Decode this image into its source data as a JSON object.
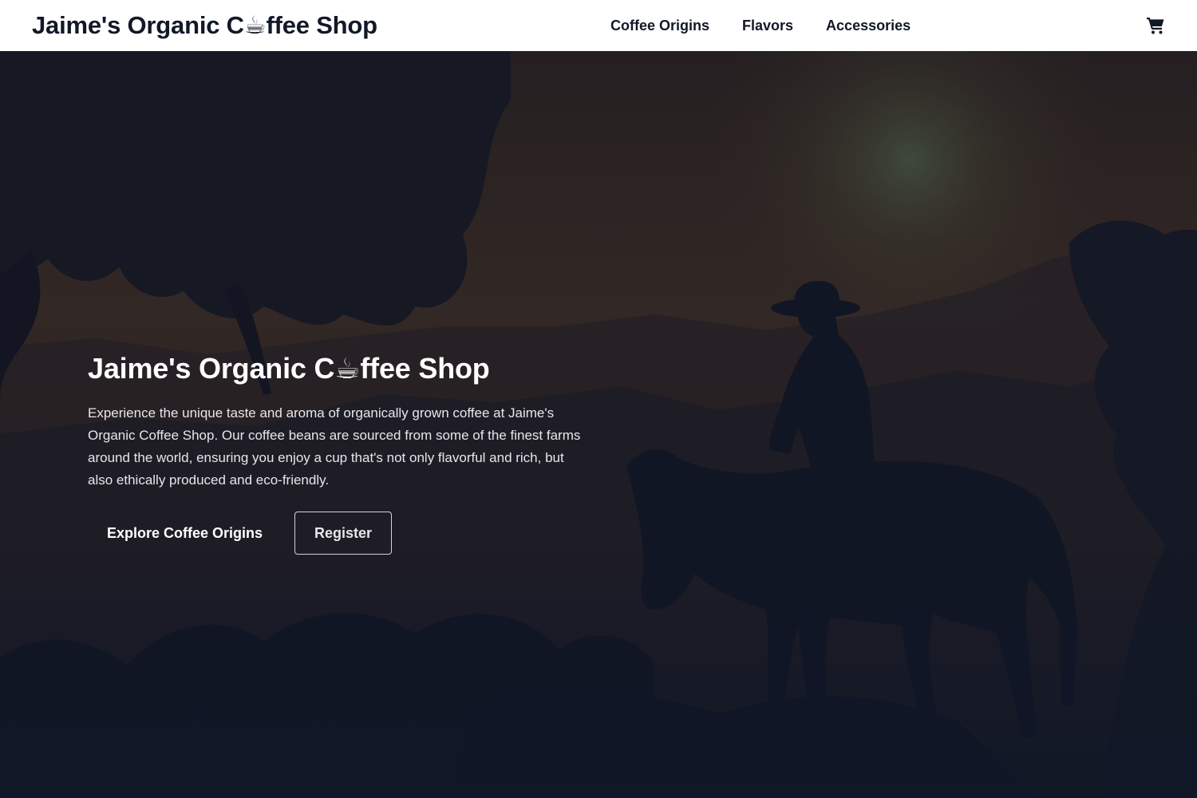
{
  "header": {
    "brand_prefix": "Jaime's Organic C",
    "brand_cup": "☕",
    "brand_suffix": "ffee Shop",
    "nav": [
      {
        "label": "Coffee Origins"
      },
      {
        "label": "Flavors"
      },
      {
        "label": "Accessories"
      }
    ],
    "cart_icon": "shopping-cart-icon"
  },
  "hero": {
    "title_prefix": "Jaime's Organic C",
    "title_cup": "☕",
    "title_suffix": "ffee Shop",
    "description": "Experience the unique taste and aroma of organically grown coffee at Jaime's Organic Coffee Shop. Our coffee beans are sourced from some of the finest farms around the world, ensuring you enjoy a cup that's not only flavorful and rich, but also ethically produced and eco-friendly.",
    "primary_cta": "Explore Coffee Origins",
    "secondary_cta": "Register",
    "background_image": "horseman-silhouette-in-forest"
  },
  "colors": {
    "header_bg": "#ffffff",
    "text_dark": "#111827",
    "hero_text": "#ffffff",
    "hero_bg": "#111827"
  }
}
